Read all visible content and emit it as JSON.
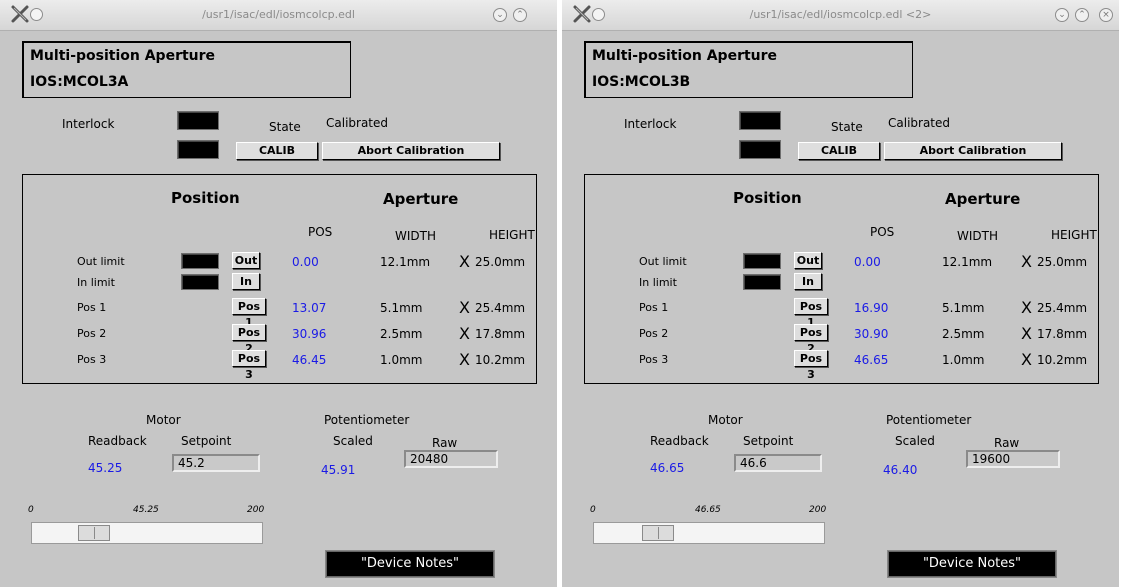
{
  "windows": [
    {
      "title": "/usr1/isac/edl/iosmcolcp.edl",
      "header": {
        "line1": "Multi-position Aperture",
        "line2": "IOS:MCOL3A"
      },
      "interlock_label": "Interlock",
      "state_label": "State",
      "state_value": "Calibrated",
      "calib_button": "CALIB",
      "abort_button": "Abort Calibration",
      "position_heading": "Position",
      "aperture_heading": "Aperture",
      "col_pos": "POS",
      "col_width": "WIDTH",
      "col_height": "HEIGHT",
      "x_mark": "X",
      "rows": [
        {
          "label": "Out limit",
          "button": "Out",
          "pos": "0.00",
          "width": "12.1mm",
          "height": "25.0mm"
        },
        {
          "label": "In limit",
          "button": "In",
          "pos": "",
          "width": "",
          "height": ""
        },
        {
          "label": "Pos 1",
          "button": "Pos 1",
          "pos": "13.07",
          "width": "5.1mm",
          "height": "25.4mm"
        },
        {
          "label": "Pos 2",
          "button": "Pos 2",
          "pos": "30.96",
          "width": "2.5mm",
          "height": "17.8mm"
        },
        {
          "label": "Pos 3",
          "button": "Pos 3",
          "pos": "46.45",
          "width": "1.0mm",
          "height": "10.2mm"
        }
      ],
      "motor_label": "Motor",
      "readback_label": "Readback",
      "setpoint_label": "Setpoint",
      "readback_value": "45.25",
      "setpoint_value": "45.2",
      "pot_label": "Potentiometer",
      "scaled_label": "Scaled",
      "raw_label": "Raw",
      "scaled_value": "45.91",
      "raw_value": "20480",
      "slider_min": "0",
      "slider_val": "45.25",
      "slider_max": "200",
      "slider_fraction": 0.226,
      "notes_button": "\"Device Notes\""
    },
    {
      "title": "/usr1/isac/edl/iosmcolcp.edl <2>",
      "header": {
        "line1": "Multi-position Aperture",
        "line2": "IOS:MCOL3B"
      },
      "interlock_label": "Interlock",
      "state_label": "State",
      "state_value": "Calibrated",
      "calib_button": "CALIB",
      "abort_button": "Abort Calibration",
      "position_heading": "Position",
      "aperture_heading": "Aperture",
      "col_pos": "POS",
      "col_width": "WIDTH",
      "col_height": "HEIGHT",
      "x_mark": "X",
      "rows": [
        {
          "label": "Out limit",
          "button": "Out",
          "pos": "0.00",
          "width": "12.1mm",
          "height": "25.0mm"
        },
        {
          "label": "In limit",
          "button": "In",
          "pos": "",
          "width": "",
          "height": ""
        },
        {
          "label": "Pos 1",
          "button": "Pos 1",
          "pos": "16.90",
          "width": "5.1mm",
          "height": "25.4mm"
        },
        {
          "label": "Pos 2",
          "button": "Pos 2",
          "pos": "30.90",
          "width": "2.5mm",
          "height": "17.8mm"
        },
        {
          "label": "Pos 3",
          "button": "Pos 3",
          "pos": "46.65",
          "width": "1.0mm",
          "height": "10.2mm"
        }
      ],
      "motor_label": "Motor",
      "readback_label": "Readback",
      "setpoint_label": "Setpoint",
      "readback_value": "46.65",
      "setpoint_value": "46.6",
      "pot_label": "Potentiometer",
      "scaled_label": "Scaled",
      "raw_label": "Raw",
      "scaled_value": "46.40",
      "raw_value": "19600",
      "slider_min": "0",
      "slider_val": "46.65",
      "slider_max": "200",
      "slider_fraction": 0.233,
      "notes_button": "\"Device Notes\""
    }
  ],
  "colors": {
    "value_blue": "#1a1ae6",
    "panel_bg": "#c6c6c6"
  },
  "icons": [
    "x-logo-icon",
    "minimize-icon",
    "maximize-icon",
    "close-icon"
  ]
}
